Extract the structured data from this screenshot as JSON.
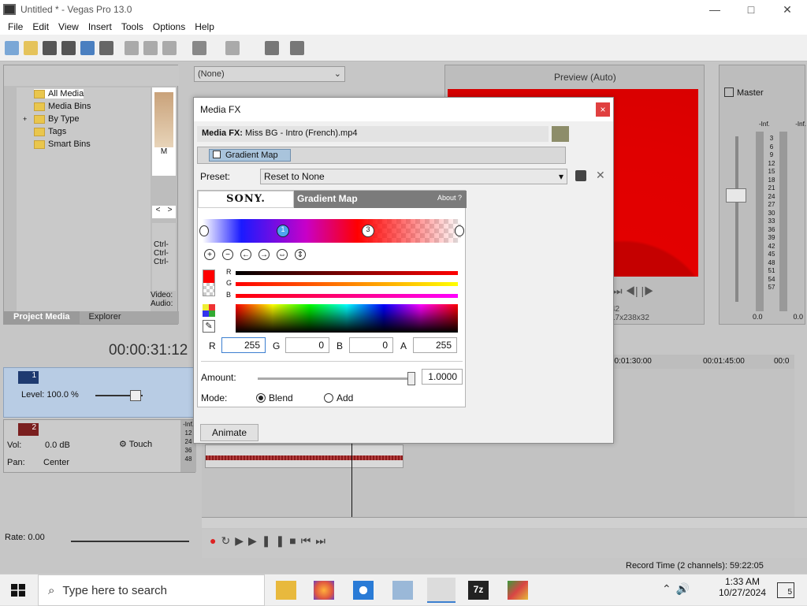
{
  "window": {
    "title": "Untitled * - Vegas Pro 13.0",
    "minimize": "—",
    "maximize": "□",
    "close": "✕"
  },
  "menu": [
    "File",
    "Edit",
    "View",
    "Insert",
    "Tools",
    "Options",
    "Help"
  ],
  "project_media": {
    "tree": [
      "All Media",
      "Media Bins",
      "By Type",
      "Tags",
      "Smart Bins"
    ],
    "expand": "+",
    "tabs": [
      "Project Media",
      "Explorer"
    ],
    "thumb_label": "M",
    "ctrl_lines": [
      "Ctrl-",
      "Ctrl-",
      "Ctrl-"
    ],
    "info_lines": [
      "Video:",
      "Audio:"
    ]
  },
  "fx_preset_dropdown": "(None)",
  "preview": {
    "mode": "Preview (Auto)",
    "info_lines": [
      "42",
      "17x238x32"
    ]
  },
  "master": {
    "label": "Master",
    "inf": [
      "-Inf.",
      "-Inf."
    ],
    "scale": [
      "3",
      "6",
      "9",
      "12",
      "15",
      "18",
      "21",
      "24",
      "27",
      "30",
      "33",
      "36",
      "39",
      "42",
      "45",
      "48",
      "51",
      "54",
      "57"
    ],
    "values": [
      "0.0",
      "0.0"
    ]
  },
  "timeline": {
    "timecode": "00:00:31:12",
    "ruler": [
      "00:01:30:00",
      "00:01:45:00",
      "00:0"
    ],
    "track1": {
      "num": "1",
      "level": "Level: 100.0 %"
    },
    "track2": {
      "num": "2",
      "vol_label": "Vol:",
      "vol": "0.0 dB",
      "pan_label": "Pan:",
      "pan": "Center",
      "touch": "Touch",
      "meter": [
        "-Inf.",
        "12",
        "24",
        "36",
        "48"
      ]
    },
    "rate": "Rate: 0.00",
    "record_time": "Record Time (2 channels): 59:22:05"
  },
  "dialog": {
    "title": "Media FX",
    "close": "×",
    "media_fx_label": "Media FX:",
    "media_fx_file": "Miss BG - Intro (French).mp4",
    "chain_plugin": "Gradient Map",
    "preset_label": "Preset:",
    "preset_value": "Reset to None",
    "sony": "SONY.",
    "plugin_title": "Gradient Map",
    "about": "About  ?",
    "markers": [
      "1",
      "3"
    ],
    "channel_labels": [
      "R",
      "G",
      "B"
    ],
    "rgba_labels": [
      "R",
      "G",
      "B",
      "A"
    ],
    "rgba_values": [
      "255",
      "0",
      "0",
      "255"
    ],
    "amount_label": "Amount:",
    "amount_value": "1.0000",
    "amount_fraction": 1.0,
    "mode_label": "Mode:",
    "mode_options": [
      "Blend",
      "Add"
    ],
    "mode_selected": "Blend",
    "animate": "Animate"
  },
  "taskbar": {
    "search_placeholder": "Type here to search",
    "time": "1:33 AM",
    "date": "10/27/2024",
    "notifications": "5"
  },
  "colors": {
    "accent": "#e3201b",
    "dim_bg": "#c6c6c6",
    "track_blue": "#b8cce4"
  }
}
